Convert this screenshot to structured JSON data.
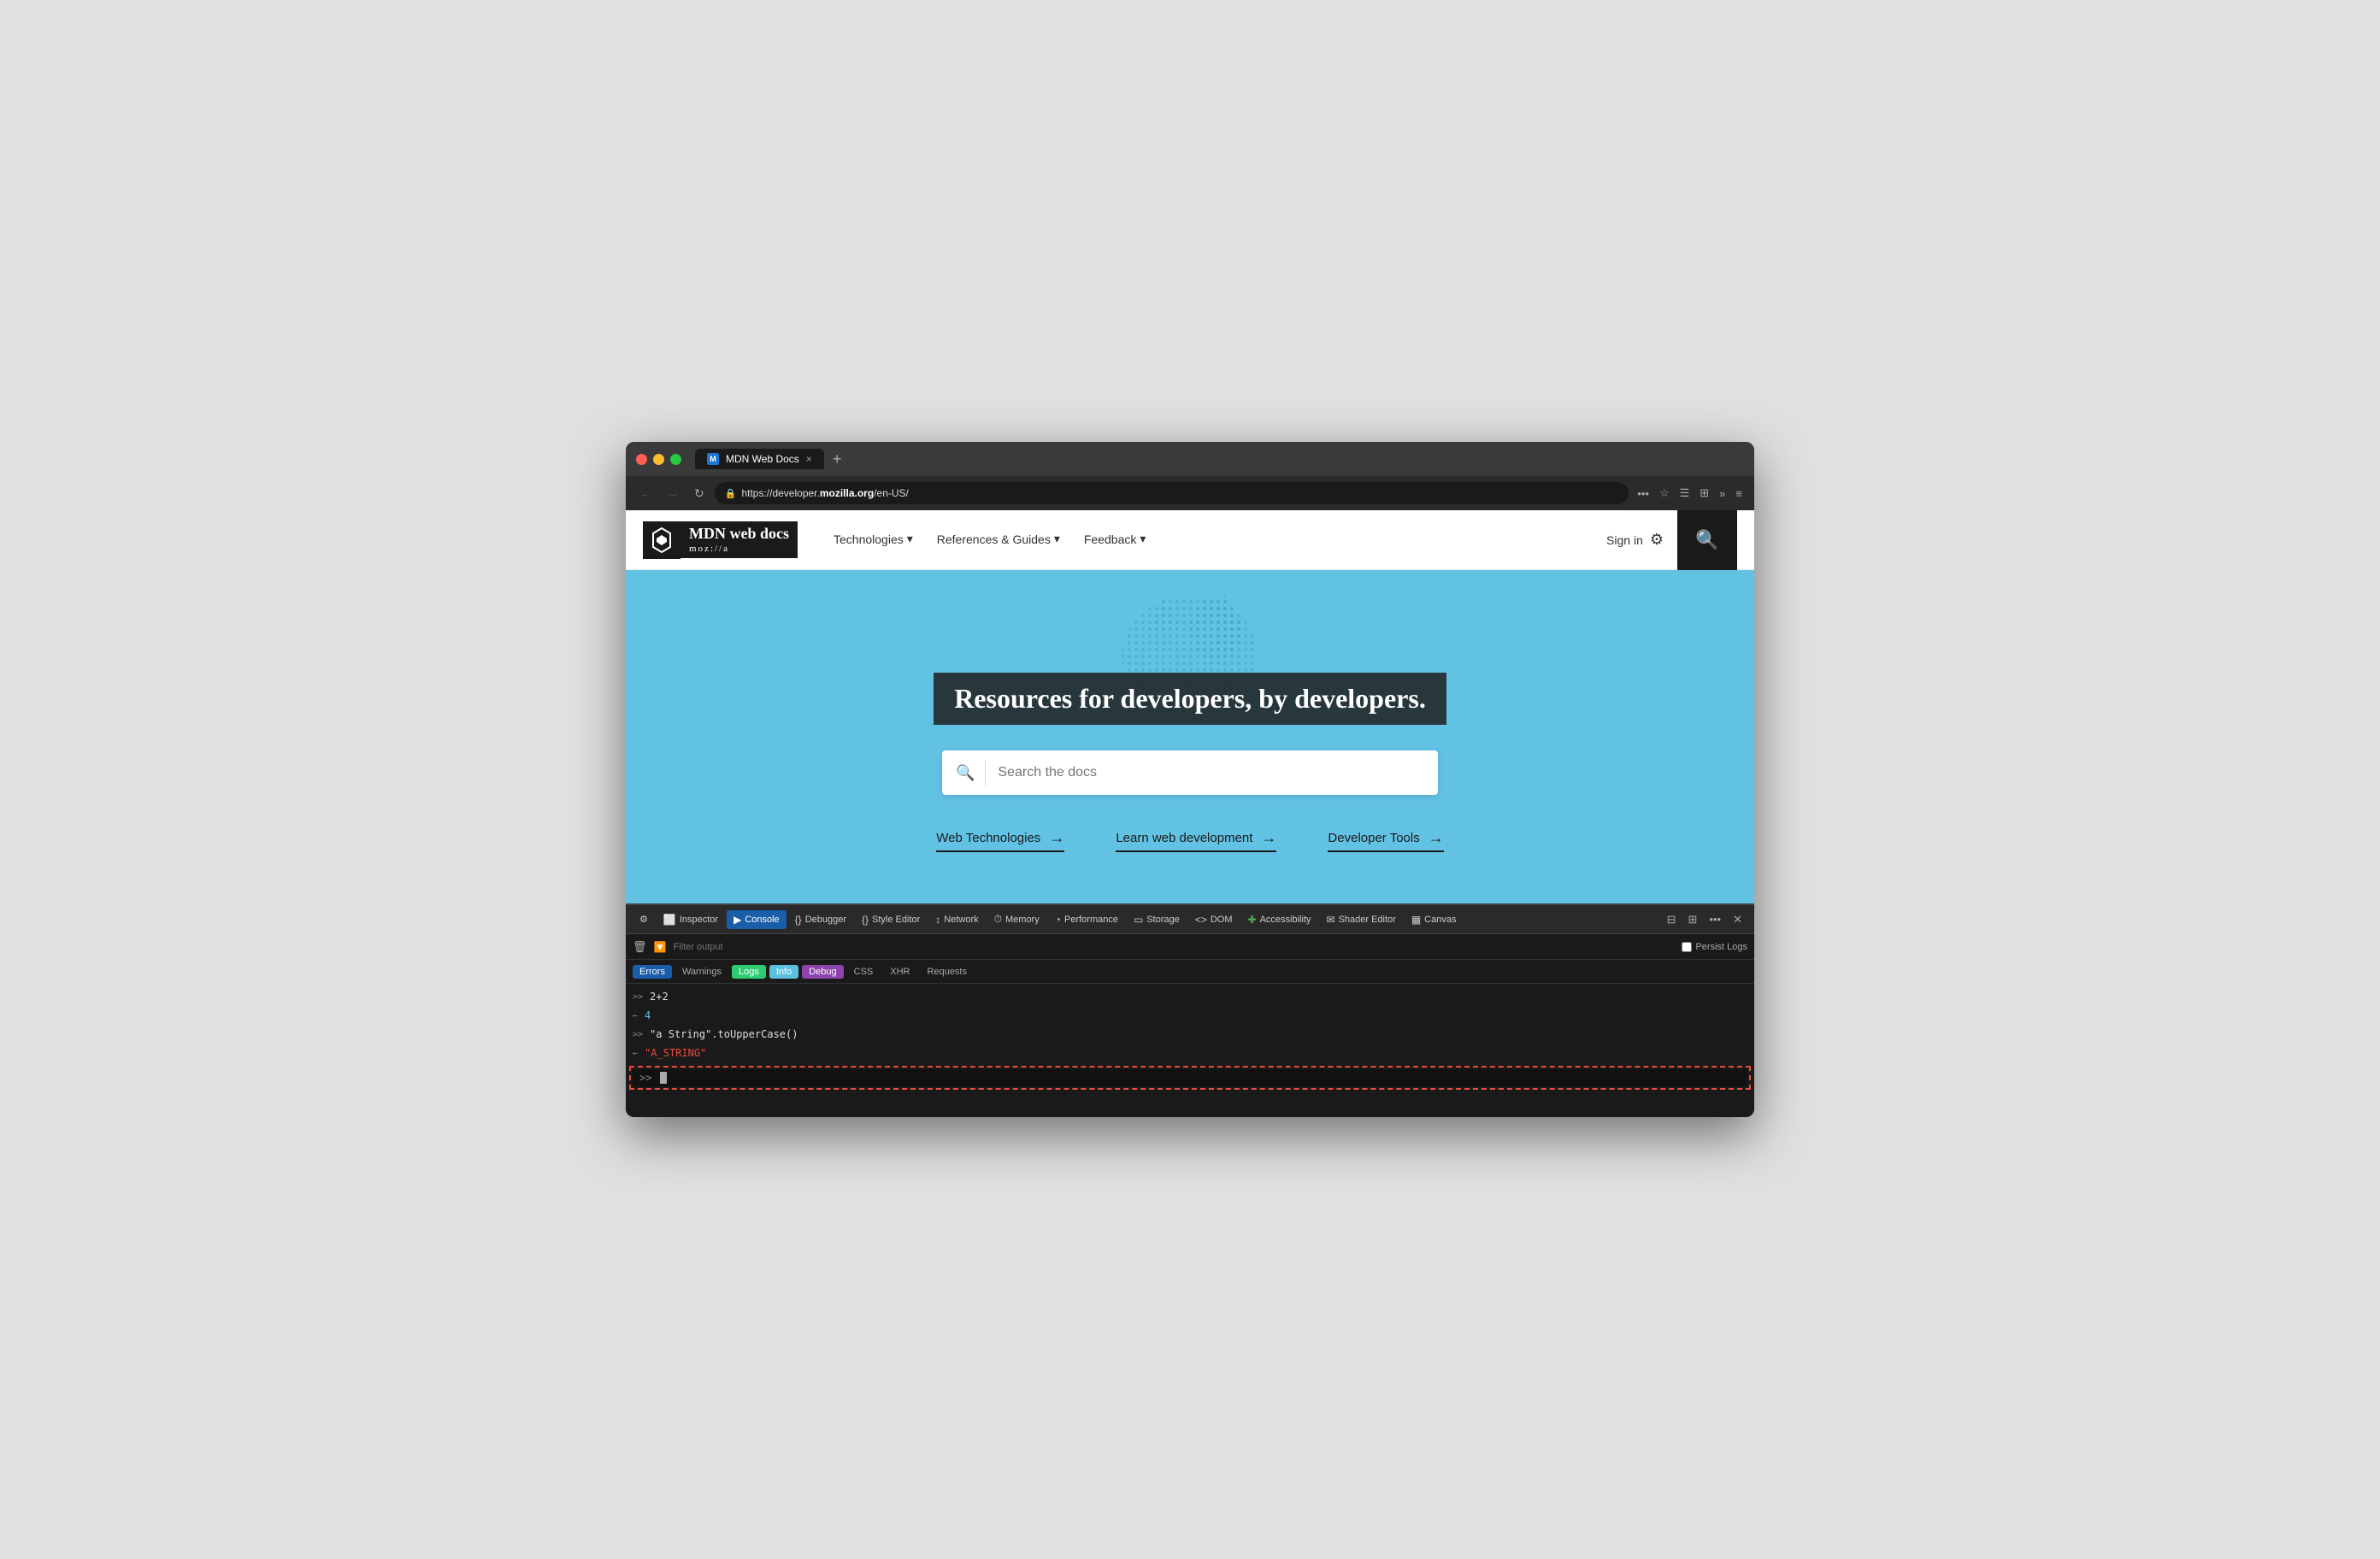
{
  "browser": {
    "title": "MDN Web Docs",
    "url_prefix": "https://developer.",
    "url_domain": "mozilla.org",
    "url_path": "/en-US/",
    "tab_label": "MDN Web Docs",
    "new_tab_symbol": "+",
    "close_tab_symbol": "×"
  },
  "nav": {
    "back_label": "←",
    "forward_label": "→",
    "refresh_label": "↻",
    "more_btn": "•••",
    "bookmark_icon": "☆",
    "reader_icon": "☰",
    "sidebar_icon": "⊞",
    "overflow_icon": "»",
    "menu_icon": "≡"
  },
  "mdn": {
    "logo_title": "MDN web docs",
    "logo_subtitle": "moz://a",
    "nav_items": [
      {
        "label": "Technologies",
        "has_dropdown": true
      },
      {
        "label": "References & Guides",
        "has_dropdown": true
      },
      {
        "label": "Feedback",
        "has_dropdown": true
      }
    ],
    "sign_in": "Sign in",
    "search_placeholder": "Search the docs",
    "hero_title": "Resources for developers, by developers.",
    "hero_links": [
      {
        "label": "Web Technologies",
        "arrow": "→"
      },
      {
        "label": "Learn web development",
        "arrow": "→"
      },
      {
        "label": "Developer Tools",
        "arrow": "→"
      }
    ]
  },
  "devtools": {
    "tools": [
      {
        "label": "Inspector",
        "icon": "⬜",
        "active": false
      },
      {
        "label": "Console",
        "icon": "▶",
        "active": true
      },
      {
        "label": "Debugger",
        "icon": "{}",
        "active": false
      },
      {
        "label": "Style Editor",
        "icon": "{}",
        "active": false
      },
      {
        "label": "Network",
        "icon": "↕",
        "active": false
      },
      {
        "label": "Memory",
        "icon": "⏱",
        "active": false
      },
      {
        "label": "Performance",
        "icon": "◔",
        "active": false
      },
      {
        "label": "Storage",
        "icon": "▭",
        "active": false
      },
      {
        "label": "DOM",
        "icon": "<>",
        "active": false
      },
      {
        "label": "Accessibility",
        "icon": "✚",
        "active": false
      },
      {
        "label": "Shader Editor",
        "icon": "✉",
        "active": false
      },
      {
        "label": "Canvas",
        "icon": "▦",
        "active": false
      }
    ],
    "filter_placeholder": "Filter output",
    "persist_logs_label": "Persist Logs",
    "levels": [
      {
        "label": "Errors",
        "style": "active-blue"
      },
      {
        "label": "Warnings",
        "style": ""
      },
      {
        "label": "Logs",
        "style": "active-teal"
      },
      {
        "label": "Info",
        "style": "active-light-blue"
      },
      {
        "label": "Debug",
        "style": "active-purple"
      },
      {
        "label": "CSS",
        "style": ""
      },
      {
        "label": "XHR",
        "style": ""
      },
      {
        "label": "Requests",
        "style": ""
      }
    ],
    "console_lines": [
      {
        "type": "input",
        "content": "2+2"
      },
      {
        "type": "output",
        "content": "4"
      },
      {
        "type": "input",
        "content": "\"a String\".toUpperCase()"
      },
      {
        "type": "output",
        "content": "\"A_STRING\""
      }
    ],
    "prompt_symbol": "»"
  }
}
